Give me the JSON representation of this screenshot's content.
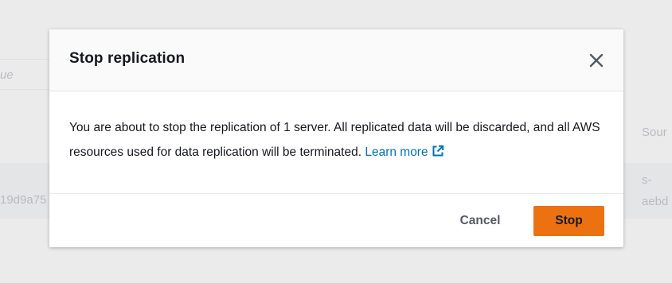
{
  "background": {
    "column_placeholder": "ue",
    "column_header_right": "Sour",
    "row_id_fragment": "19d9a75",
    "row_source_line1": "s-",
    "row_source_line2": "aebd"
  },
  "modal": {
    "title": "Stop replication",
    "close_icon": "close-icon",
    "body_text": "You are about to stop the replication of 1 server. All replicated data will be discarded, and all AWS resources used for data replication will be terminated.",
    "learn_more_label": "Learn more",
    "external_link_icon": "external-link-icon",
    "cancel_label": "Cancel",
    "stop_label": "Stop"
  },
  "colors": {
    "primary_button": "#ec7211",
    "link": "#0073bb",
    "overlay": "#ebebeb"
  }
}
